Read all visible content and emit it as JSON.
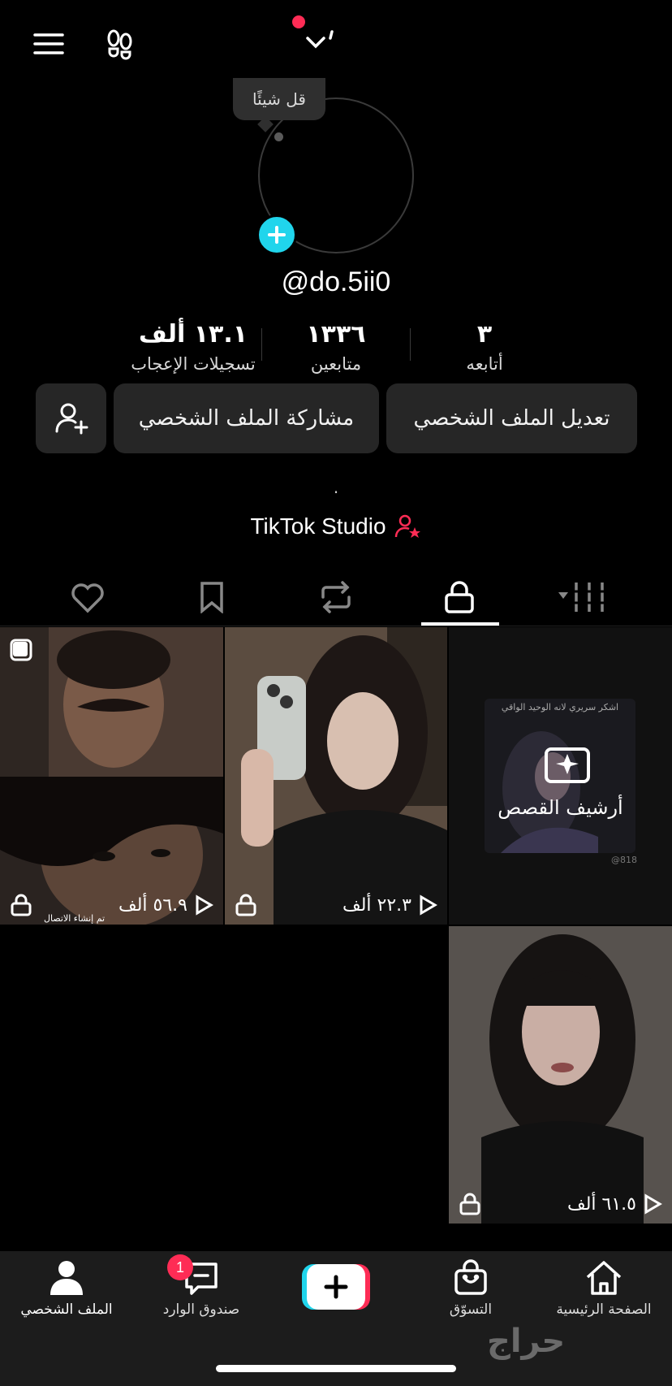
{
  "header": {
    "menu_icon": "hamburger-menu-icon",
    "footprints_icon": "footprints-icon",
    "switch_account_icon": "chevron-down-icon"
  },
  "profile": {
    "speech_bubble": "قل شيئًا",
    "username": "@do.5ii0",
    "stats": {
      "likes_value": "١٣.١ ألف",
      "likes_label": "تسجيلات الإعجاب",
      "followers_value": "١٣٣٦",
      "followers_label": "متابعين",
      "following_value": "٣",
      "following_label": "أتابعه"
    },
    "edit_button": "تعديل الملف الشخصي",
    "share_button": "مشاركة الملف الشخصي",
    "bio": ".",
    "studio_link": "TikTok Studio"
  },
  "tabs": [
    "grid",
    "private",
    "reposts",
    "saved",
    "liked"
  ],
  "grid": [
    {
      "views": "٥٦.٩ ألف",
      "locked": true,
      "caption": "تم إنشاء الاتصال"
    },
    {
      "views": "٢٢.٣ ألف",
      "locked": true
    },
    {
      "label": "أرشيف القصص",
      "card_header": "اشكر سريري لانه الوحيد الواقي",
      "card_handle": "@818"
    },
    {
      "views": "٦١.٥ ألف",
      "locked": true
    }
  ],
  "bottom_nav": {
    "home": "الصفحة الرئيسية",
    "shop": "التسوّق",
    "inbox": "صندوق الوارد",
    "inbox_badge": "1",
    "profile": "الملف الشخصي"
  },
  "watermark": "حراج",
  "colors": {
    "accent_red": "#fe2c55",
    "accent_cyan": "#20d5ec",
    "button_bg": "#262626"
  }
}
